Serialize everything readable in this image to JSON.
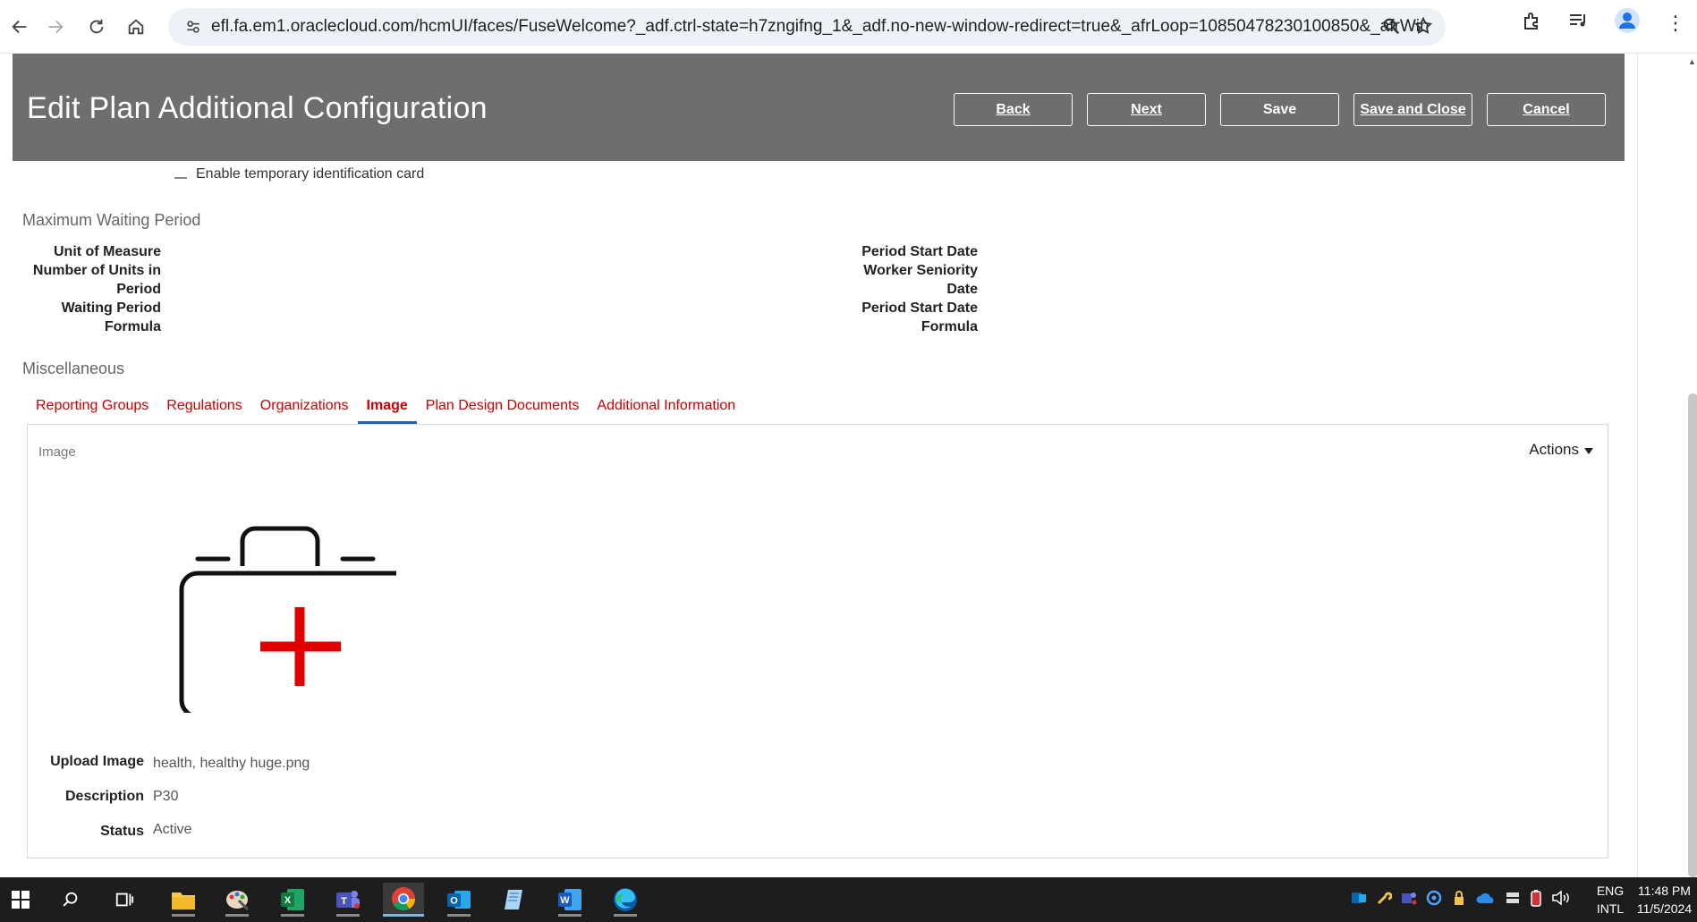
{
  "browser": {
    "url": "efl.fa.em1.oraclecloud.com/hcmUI/faces/FuseWelcome?_adf.ctrl-state=h7zngifng_1&_adf.no-new-window-redirect=true&_afrLoop=10850478230100850&_afrWindowMode=2..."
  },
  "header": {
    "title": "Edit Plan Additional Configuration",
    "buttons": {
      "back": "Back",
      "next": "Next",
      "save": "Save",
      "save_close": "Save and Close",
      "cancel": "Cancel"
    }
  },
  "checkbox_row": {
    "label": "Enable temporary identification card"
  },
  "max_waiting": {
    "title": "Maximum Waiting Period",
    "left_labels": [
      "Unit of Measure",
      "Number of Units in",
      "Period",
      "Waiting Period",
      "Formula"
    ],
    "right_labels": [
      "Period Start Date",
      "Worker Seniority",
      "Date",
      "Period Start Date",
      "Formula"
    ]
  },
  "misc": {
    "title": "Miscellaneous",
    "tabs": [
      "Reporting Groups",
      "Regulations",
      "Organizations",
      "Image",
      "Plan Design Documents",
      "Additional Information"
    ],
    "active_tab": "Image"
  },
  "image_panel": {
    "title": "Image",
    "actions_label": "Actions",
    "fields": {
      "upload_label": "Upload Image",
      "upload_value": "health, healthy huge.png",
      "description_label": "Description",
      "description_value": "P30",
      "status_label": "Status",
      "status_value": "Active"
    }
  },
  "taskbar": {
    "lang_top": "ENG",
    "lang_bottom": "INTL",
    "time": "11:48 PM",
    "date": "11/5/2024"
  },
  "colors": {
    "header_band": "#6e6e6e",
    "tab_text": "#cc0000",
    "tab_active_underline": "#1d62b5",
    "red_cross": "#e00000"
  }
}
